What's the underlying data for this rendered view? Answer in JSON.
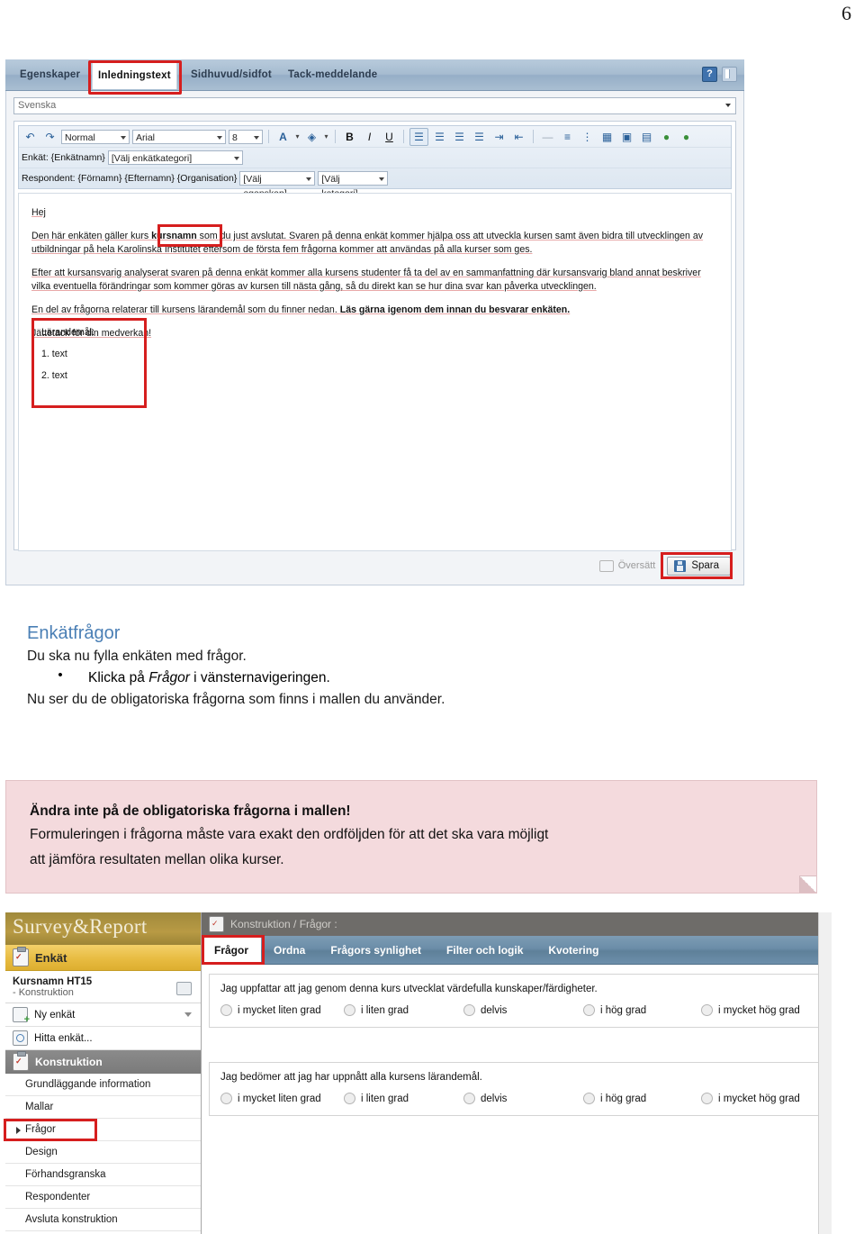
{
  "page_number": "6",
  "top_screenshot": {
    "tabs": [
      {
        "label": "Egenskaper",
        "active": false
      },
      {
        "label": "Inledningstext",
        "active": true
      },
      {
        "label": "Sidhuvud/sidfot",
        "active": false
      },
      {
        "label": "Tack-meddelande",
        "active": false
      }
    ],
    "help_icon_label": "?",
    "language_select": {
      "value": "Svenska"
    },
    "toolbar": {
      "undo_icon": "undo-icon",
      "redo_icon": "redo-icon",
      "style_value": "Normal",
      "font_value": "Arial",
      "size_value": "8",
      "text_color_icon": "A",
      "highlight_icon": "highlight-icon",
      "bold": "B",
      "italic": "I",
      "underline": "U",
      "align_left_icon": "align-left-icon",
      "align_center_icon": "align-center-icon",
      "align_right_icon": "align-right-icon",
      "align_justify_icon": "align-justify-icon",
      "indent_decrease_icon": "indent-decrease-icon",
      "indent_increase_icon": "indent-increase-icon",
      "hr_icon": "horizontal-rule-icon",
      "ordered_list_icon": "ordered-list-icon",
      "unordered_list_icon": "unordered-list-icon",
      "table_icon": "table-icon",
      "image_icon": "image-icon",
      "spellcheck_icon": "spellcheck-icon",
      "link_icon": "insert-link-icon",
      "unlink_icon": "remove-link-icon"
    },
    "merge_row_enkat": {
      "label": "Enkät: {Enkätnamn}",
      "category_value": "[Välj enkätkategori]"
    },
    "merge_row_respondent": {
      "label": "Respondent: {Förnamn} {Efternamn} {Organisation}",
      "property_value": "[Välj egenskap]",
      "category_value": "[Välj kategori]"
    },
    "document": {
      "greeting": "Hej",
      "paragraph1_pre": "Den här enkäten gäller kurs ",
      "paragraph1_highlight": "kursnamn",
      "paragraph1_post": " som du just avslutat. Svaren på denna enkät kommer hjälpa oss att utveckla kursen samt även bidra till utvecklingen av utbildningar på hela Karolinska Institutet eftersom de första fem frågorna kommer att användas på alla kurser som ges.",
      "paragraph2": "Efter att kursansvarig analyserat svaren på denna enkät kommer alla kursens studenter få ta del av en sammanfattning där kursansvarig bland annat beskriver vilka eventuella förändringar som kommer göras av kursen till nästa gång, så du direkt kan se hur dina svar kan påverka utvecklingen.",
      "paragraph3_normal": "En del av frågorna relaterar till kursens lärandemål som du finner nedan. ",
      "paragraph3_bold": "Läs gärna igenom dem innan du besvarar enkäten.",
      "paragraph4": "Jättetack för din medverkan!",
      "learning_goals": {
        "heading": "Lärandemål:",
        "items": [
          "1. text",
          "2. text"
        ]
      }
    },
    "footer": {
      "translate_label": "Översätt",
      "save_label": "Spara"
    }
  },
  "middle_text": {
    "heading": "Enkätfrågor",
    "line1": "Du ska nu fylla enkäten med frågor.",
    "bullet_dot": "•",
    "bullet_pre": "Klicka på ",
    "bullet_em": "Frågor",
    "bullet_post": " i vänsternavigeringen.",
    "line2": "Nu ser du de obligatoriska frågorna som finns i mallen du använder."
  },
  "callout": {
    "bold_line": "Ändra inte på de obligatoriska frågorna i mallen!",
    "body_line1": "Formuleringen i frågorna måste vara exakt den ordföljden för att det ska vara möjligt",
    "body_line2": "att jämföra resultaten mellan olika kurser."
  },
  "bottom_screenshot": {
    "brand": "Survey&Report",
    "enkat_label": "Enkät",
    "course": {
      "title": "Kursnamn HT15",
      "subtitle": "- Konstruktion",
      "home_icon": "home-icon"
    },
    "nav_items": [
      {
        "label": "Ny enkät",
        "icon": "new-survey-icon",
        "has_chevron": true
      },
      {
        "label": "Hitta enkät...",
        "icon": "find-survey-icon",
        "has_chevron": false
      }
    ],
    "section_header": {
      "label": "Konstruktion",
      "icon": "construction-icon"
    },
    "sub_items": [
      {
        "label": "Grundläggande information",
        "selected": false
      },
      {
        "label": "Mallar",
        "selected": false
      },
      {
        "label": "Frågor",
        "selected": true
      },
      {
        "label": "Design",
        "selected": false
      },
      {
        "label": "Förhandsgranska",
        "selected": false
      },
      {
        "label": "Respondenter",
        "selected": false
      },
      {
        "label": "Avsluta konstruktion",
        "selected": false
      }
    ],
    "breadcrumb": "Konstruktion / Frågor :",
    "sub_tabs": [
      {
        "label": "Frågor",
        "active": true
      },
      {
        "label": "Ordna",
        "active": false
      },
      {
        "label": "Frågors synlighet",
        "active": false
      },
      {
        "label": "Filter och logik",
        "active": false
      },
      {
        "label": "Kvotering",
        "active": false
      }
    ],
    "questions": [
      {
        "text": "Jag uppfattar att jag genom denna kurs utvecklat värdefulla kunskaper/färdigheter.",
        "options": [
          "i mycket liten grad",
          "i liten grad",
          "delvis",
          "i hög grad",
          "i mycket hög grad"
        ]
      },
      {
        "text": "Jag bedömer att jag har uppnått alla kursens lärandemål.",
        "options": [
          "i mycket liten grad",
          "i liten grad",
          "delvis",
          "i hög grad",
          "i mycket hög grad"
        ]
      }
    ]
  },
  "colors": {
    "highlight_red": "#d61e1e",
    "heading_blue": "#4a7fb5",
    "callout_pink": "#f4dadd",
    "brand_gold": "#b89a44"
  }
}
